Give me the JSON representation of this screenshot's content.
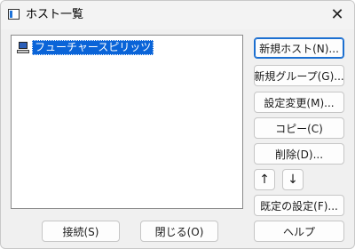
{
  "window": {
    "title": "ホスト一覧",
    "close_label": "✕"
  },
  "host_list": {
    "items": [
      {
        "label": "フューチャースピリッツ",
        "selected": true
      }
    ]
  },
  "buttons": {
    "new_host": "新規ホスト(N)...",
    "new_group": "新規グループ(G)...",
    "edit_settings": "設定変更(M)...",
    "copy": "コピー(C)",
    "delete": "削除(D)...",
    "move_up": "↑",
    "move_down": "↓",
    "default_settings": "既定の設定(F)...",
    "connect": "接続(S)",
    "close": "閉じる(O)",
    "help": "ヘルプ"
  }
}
